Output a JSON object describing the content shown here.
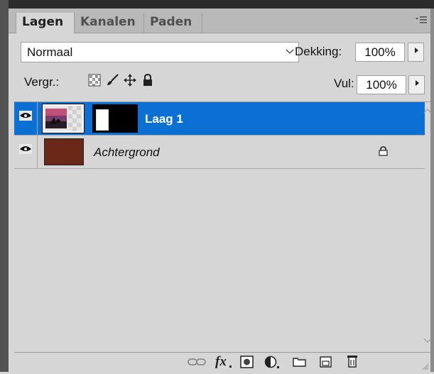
{
  "tabs": [
    {
      "label": "Lagen",
      "active": true
    },
    {
      "label": "Kanalen",
      "active": false
    },
    {
      "label": "Paden",
      "active": false
    }
  ],
  "tab_menu_icon": "panel-menu-icon",
  "blend": {
    "value": "Normaal",
    "arrow_icon": "chevron-down-icon"
  },
  "opacity": {
    "label": "Dekking:",
    "value": "100%"
  },
  "lock": {
    "label": "Vergr.:",
    "icons": [
      "lock-transparency-icon",
      "lock-paint-icon",
      "lock-position-icon",
      "lock-all-icon"
    ]
  },
  "fill": {
    "label": "Vul:",
    "value": "100%"
  },
  "layers": [
    {
      "name": "Laag 1",
      "selected": true,
      "visible": true,
      "has_mask": true
    },
    {
      "name": "Achtergrond",
      "selected": false,
      "visible": true,
      "locked": true,
      "color": "#6b2818"
    }
  ],
  "bottom_toolbar": [
    "link-layers-icon",
    "fx-icon",
    "add-mask-icon",
    "adjustment-layer-icon",
    "new-group-icon",
    "new-layer-icon",
    "delete-layer-icon"
  ],
  "colors": {
    "selection": "#0a70d3",
    "panel": "#d6d6d6",
    "tabbar": "#b9b9b9"
  }
}
